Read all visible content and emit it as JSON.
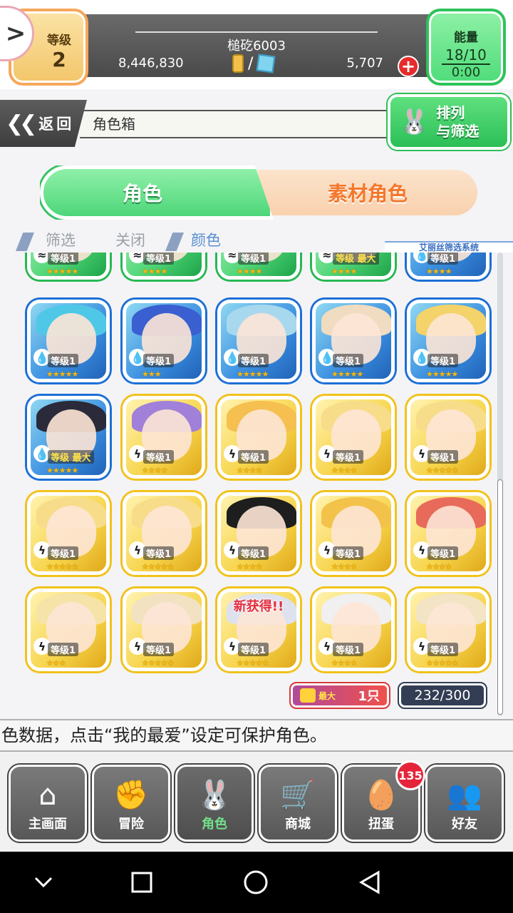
{
  "header": {
    "level_label": "等级",
    "level_value": "2",
    "player_name": "槌矻6003",
    "coins": "8,446,830",
    "currency_separator": "/",
    "gems": "5,707",
    "energy_label": "能量",
    "energy_value": "18/10",
    "energy_timer": "0:00"
  },
  "nav": {
    "back_label": "返回",
    "page_path": "角色箱",
    "sort_filter_line1": "排列",
    "sort_filter_line2": "与筛选"
  },
  "tabs": {
    "characters": "角色",
    "material_characters": "素材角色"
  },
  "filter": {
    "filter_label": "筛选",
    "off_label": "关闭",
    "color_label": "颜色",
    "system_label": "艾丽丝筛选系统"
  },
  "cards": [
    {
      "element": "wind",
      "level": "等级1",
      "stars": "★★★★★",
      "hair": "#d889b8",
      "partial": true
    },
    {
      "element": "wind",
      "level": "等级1",
      "stars": "★★★★",
      "hair": "#c09070",
      "partial": true
    },
    {
      "element": "wind",
      "level": "等级1",
      "stars": "★★★★",
      "hair": "#b06b5a",
      "partial": true
    },
    {
      "element": "wind",
      "level": "等级 最大",
      "stars": "★★★★",
      "hair": "#d0a060",
      "partial": true,
      "max": true
    },
    {
      "element": "water",
      "level": "等级1",
      "stars": "★★★★",
      "hair": "#e08a9a",
      "partial": true
    },
    {
      "element": "water",
      "level": "等级1",
      "stars": "★★★★★",
      "hair": "#4fc8e8"
    },
    {
      "element": "water",
      "level": "等级1",
      "stars": "★★★",
      "hair": "#3a5fd0"
    },
    {
      "element": "water",
      "level": "等级1",
      "stars": "★★★★★",
      "hair": "#a8d8ee"
    },
    {
      "element": "water",
      "level": "等级1",
      "stars": "★★★★★",
      "hair": "#f0dcc0"
    },
    {
      "element": "water",
      "level": "等级1",
      "stars": "★★★★★",
      "hair": "#f3d36a"
    },
    {
      "element": "water",
      "level": "等级 最大",
      "stars": "★★★★★",
      "hair": "#2a2a3a",
      "max": true
    },
    {
      "element": "thunder",
      "level": "等级1",
      "stars": "★★★★",
      "hair": "#a080d8"
    },
    {
      "element": "thunder",
      "level": "等级1",
      "stars": "★★★★",
      "hair": "#f5c050"
    },
    {
      "element": "thunder",
      "level": "等级1",
      "stars": "★★★★",
      "hair": "#f7dc8a"
    },
    {
      "element": "thunder",
      "level": "等级1",
      "stars": "★★★★★",
      "hair": "#f7dc8a"
    },
    {
      "element": "thunder",
      "level": "等级1",
      "stars": "★★★★★",
      "hair": "#f7dc8a"
    },
    {
      "element": "thunder",
      "level": "等级1",
      "stars": "★★★★★",
      "hair": "#f7dc8a"
    },
    {
      "element": "thunder",
      "level": "等级1",
      "stars": "★★★★",
      "hair": "#1e1e1e"
    },
    {
      "element": "thunder",
      "level": "等级1",
      "stars": "★★★★",
      "hair": "#f3c24a"
    },
    {
      "element": "thunder",
      "level": "等级1",
      "stars": "★★★★",
      "hair": "#e86a5a"
    },
    {
      "element": "thunder",
      "level": "等级1",
      "stars": "★★★",
      "hair": "#f5e3a8"
    },
    {
      "element": "thunder",
      "level": "等级1",
      "stars": "★★★★★",
      "hair": "#f2e2c2"
    },
    {
      "element": "thunder",
      "level": "等级1",
      "stars": "★★★★★",
      "hair": "#dde2ee",
      "new": "新获得!!"
    },
    {
      "element": "thunder",
      "level": "等级1",
      "stars": "★★★★",
      "hair": "#f0f0f0"
    },
    {
      "element": "thunder",
      "level": "等级1",
      "stars": "★★★★★",
      "hair": "#f2e4c4"
    }
  ],
  "footer": {
    "favorites_max": "最大",
    "favorites_count": "1只",
    "box_count": "232/300",
    "ticker": "色数据，点击“我的最爱”设定可保护角色。"
  },
  "bottom_nav": [
    {
      "label": "主画面",
      "icon": "home-icon"
    },
    {
      "label": "冒险",
      "icon": "handshake-icon"
    },
    {
      "label": "角色",
      "icon": "rabbit-icon"
    },
    {
      "label": "商城",
      "icon": "cart-icon"
    },
    {
      "label": "扭蛋",
      "icon": "egg-icon"
    },
    {
      "label": "好友",
      "icon": "friends-icon"
    }
  ],
  "gacha_badge": "135"
}
